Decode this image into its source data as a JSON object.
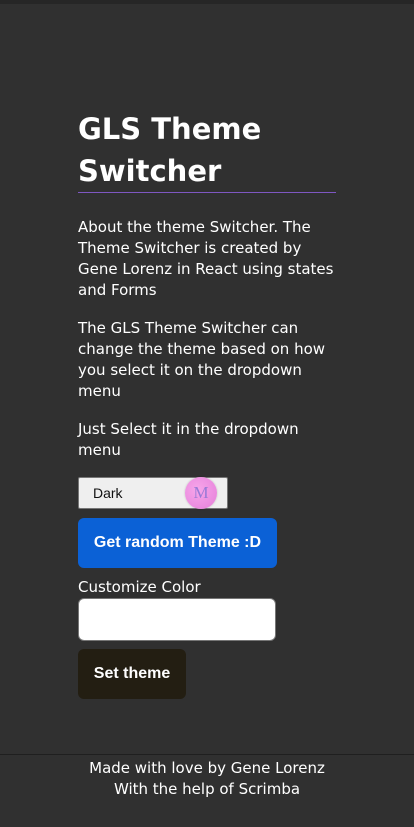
{
  "main": {
    "title": "GLS Theme Switcher",
    "paragraphs": [
      "About the theme Switcher. The Theme Switcher is created by Gene Lorenz in React using states and Forms",
      "The GLS Theme Switcher can change the theme based on how you select it on the dropdown menu",
      "Just Select it in the dropdown menu"
    ],
    "theme_select": {
      "selected": "Dark"
    },
    "extension_badge": {
      "letter": "M",
      "icon": "extension-m-icon"
    },
    "random_button_label": "Get random Theme :D",
    "customize_label": "Customize Color",
    "color_input": {
      "value": ""
    },
    "set_button_label": "Set theme"
  },
  "footer": {
    "line1": "Made with love by Gene Lorenz",
    "line2": "With the help of Scrimba"
  },
  "colors": {
    "background": "#303030",
    "accent_rule": "#7e57c2",
    "random_button": "#0b61d6",
    "set_button": "#231e12",
    "badge": "#ec8ee0"
  }
}
